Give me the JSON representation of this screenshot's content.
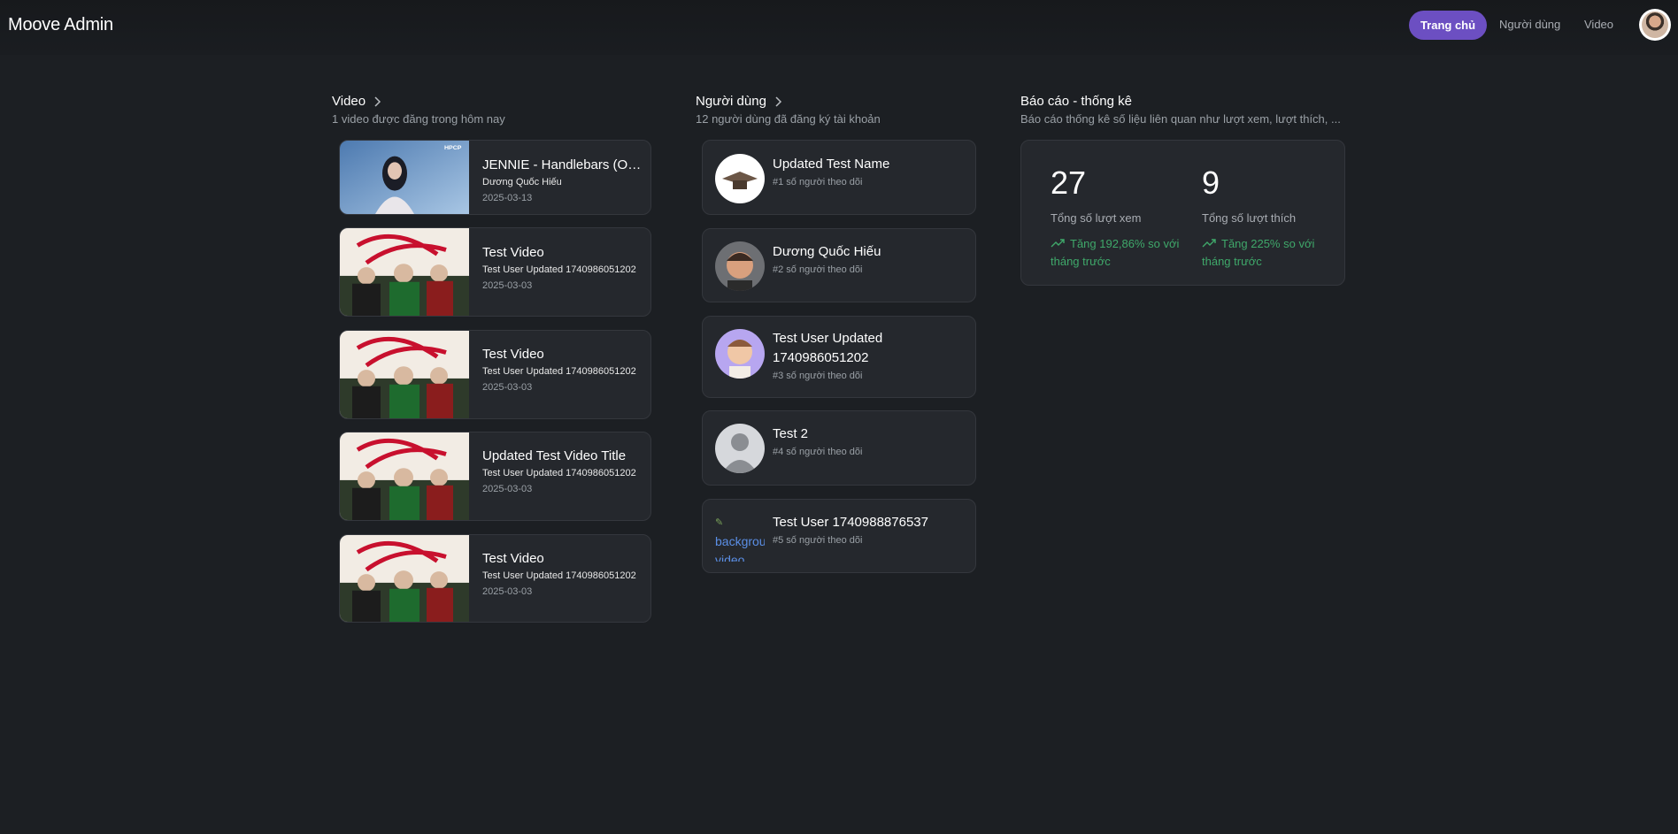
{
  "header": {
    "brand": "Moove Admin",
    "nav": {
      "home": "Trang chủ",
      "users": "Người dùng",
      "video": "Video"
    }
  },
  "videos_section": {
    "title": "Video",
    "subtitle": "1 video được đăng trong hôm nay",
    "items": [
      {
        "title": "JENNIE - Handlebars (Official Audio)",
        "author": "Dương Quốc Hiếu",
        "date": "2025-03-13",
        "thumb_badge": "HPCP"
      },
      {
        "title": "Test Video",
        "author": "Test User Updated 1740986051202",
        "date": "2025-03-03"
      },
      {
        "title": "Test Video",
        "author": "Test User Updated 1740986051202",
        "date": "2025-03-03"
      },
      {
        "title": "Updated Test Video Title",
        "author": "Test User Updated 1740986051202",
        "date": "2025-03-03"
      },
      {
        "title": "Test Video",
        "author": "Test User Updated 1740986051202",
        "date": "2025-03-03"
      }
    ]
  },
  "users_section": {
    "title": "Người dùng",
    "subtitle": "12 người dùng đã đăng ký tài khoản",
    "items": [
      {
        "name": "Updated Test Name",
        "followers": "#1 số người theo dõi"
      },
      {
        "name": "Dương Quốc Hiếu",
        "followers": "#2 số người theo dõi"
      },
      {
        "name": "Test User Updated 1740986051202",
        "followers": "#3 số người theo dõi"
      },
      {
        "name": "Test 2",
        "followers": "#4 số người theo dõi"
      },
      {
        "name": "Test User 1740988876537",
        "followers": "#5 số người theo dõi",
        "broken_img_alt": "background video"
      }
    ]
  },
  "reports_section": {
    "title": "Báo cáo - thống kê",
    "subtitle": "Báo cáo thống kê số liệu liên quan như lượt xem, lượt thích, ...",
    "stats": [
      {
        "value": "27",
        "label": "Tổng số lượt xem",
        "trend": "Tăng 192,86% so với tháng trước"
      },
      {
        "value": "9",
        "label": "Tổng số lượt thích",
        "trend": "Tăng 225% so với tháng trước"
      }
    ]
  },
  "colors": {
    "background": "#1c1f23",
    "card": "#25282d",
    "accent": "#6c4fc2",
    "trend_up": "#3fa86a"
  }
}
